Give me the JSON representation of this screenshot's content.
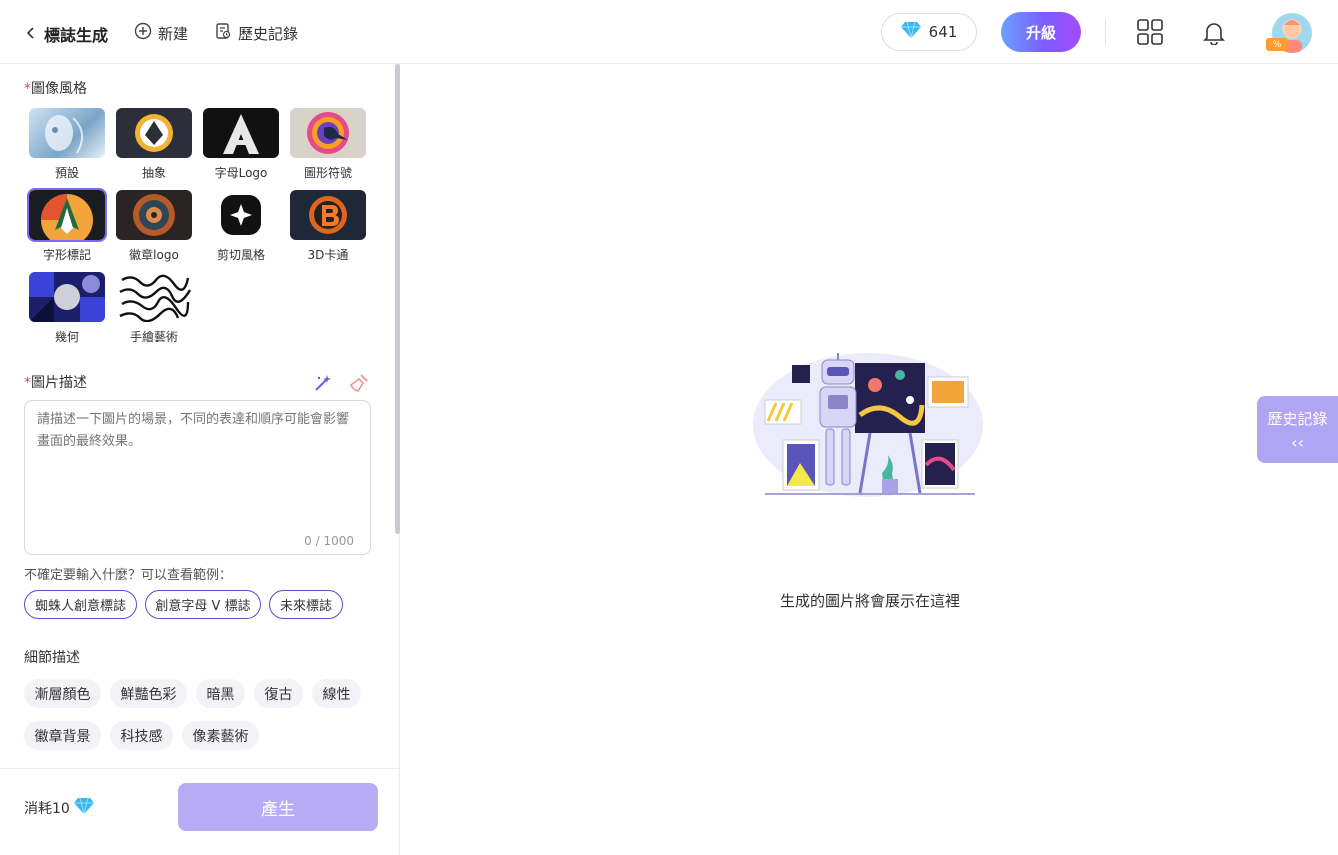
{
  "header": {
    "back_label": "標誌生成",
    "new_label": "新建",
    "history_label": "歷史記錄",
    "credits": "641",
    "upgrade_label": "升級",
    "avatar_badge": "%"
  },
  "sidebar": {
    "style_section": {
      "required_mark": "*",
      "label": "圖像風格"
    },
    "styles": [
      {
        "name": "預設"
      },
      {
        "name": "抽象"
      },
      {
        "name": "字母Logo"
      },
      {
        "name": "圖形符號"
      },
      {
        "name": "字形標記"
      },
      {
        "name": "徽章logo"
      },
      {
        "name": "剪切風格"
      },
      {
        "name": "3D卡通"
      },
      {
        "name": "幾何"
      },
      {
        "name": "手繪藝術"
      }
    ],
    "description_section": {
      "required_mark": "*",
      "label": "圖片描述"
    },
    "description": {
      "placeholder": "請描述一下圖片的場景，不同的表達和順序可能會影響畫面的最終效果。",
      "counter": "0 / 1000"
    },
    "hint": "不確定要輸入什麼？可以查看範例：",
    "examples": [
      "蜘蛛人創意標誌",
      "創意字母 V 標誌",
      "未來標誌"
    ],
    "detail_label": "細節描述",
    "details": [
      "漸層顏色",
      "鮮豔色彩",
      "暗黑",
      "復古",
      "線性",
      "徽章背景",
      "科技感",
      "像素藝術"
    ],
    "cost_label": "消耗10",
    "generate_label": "產生"
  },
  "main": {
    "placeholder_text": "生成的圖片將會展示在這裡",
    "history_tab_label": "歷史記錄",
    "history_tab_chevron": "‹‹"
  },
  "colors": {
    "accent": "#7a6cf0",
    "generate_disabled": "#b8acf6",
    "history_tab": "#b0a4f5"
  }
}
